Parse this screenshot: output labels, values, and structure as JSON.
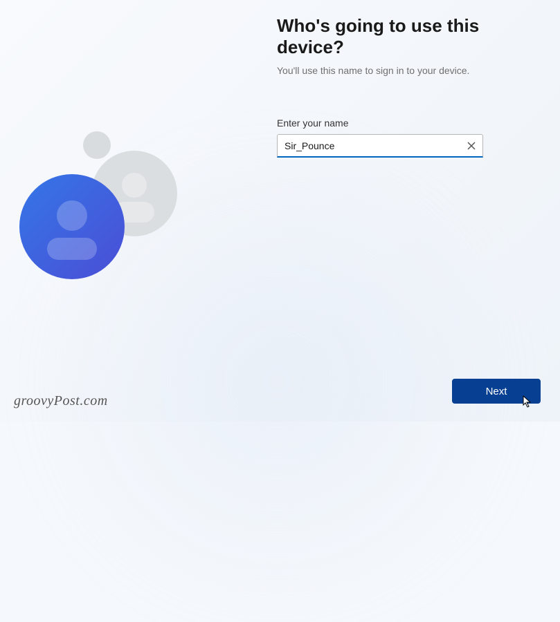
{
  "title": "Who's going to use this device?",
  "subtitle": "You'll use this name to sign in to your device.",
  "field_label": "Enter your name",
  "name_value": "Sir_Pounce",
  "next_label": "Next",
  "watermark": "groovyPost.com",
  "colors": {
    "accent": "#0067c0",
    "button_bg": "#073f92",
    "avatar_gradient_start": "#3476e8",
    "avatar_gradient_end": "#4b4ed6"
  }
}
